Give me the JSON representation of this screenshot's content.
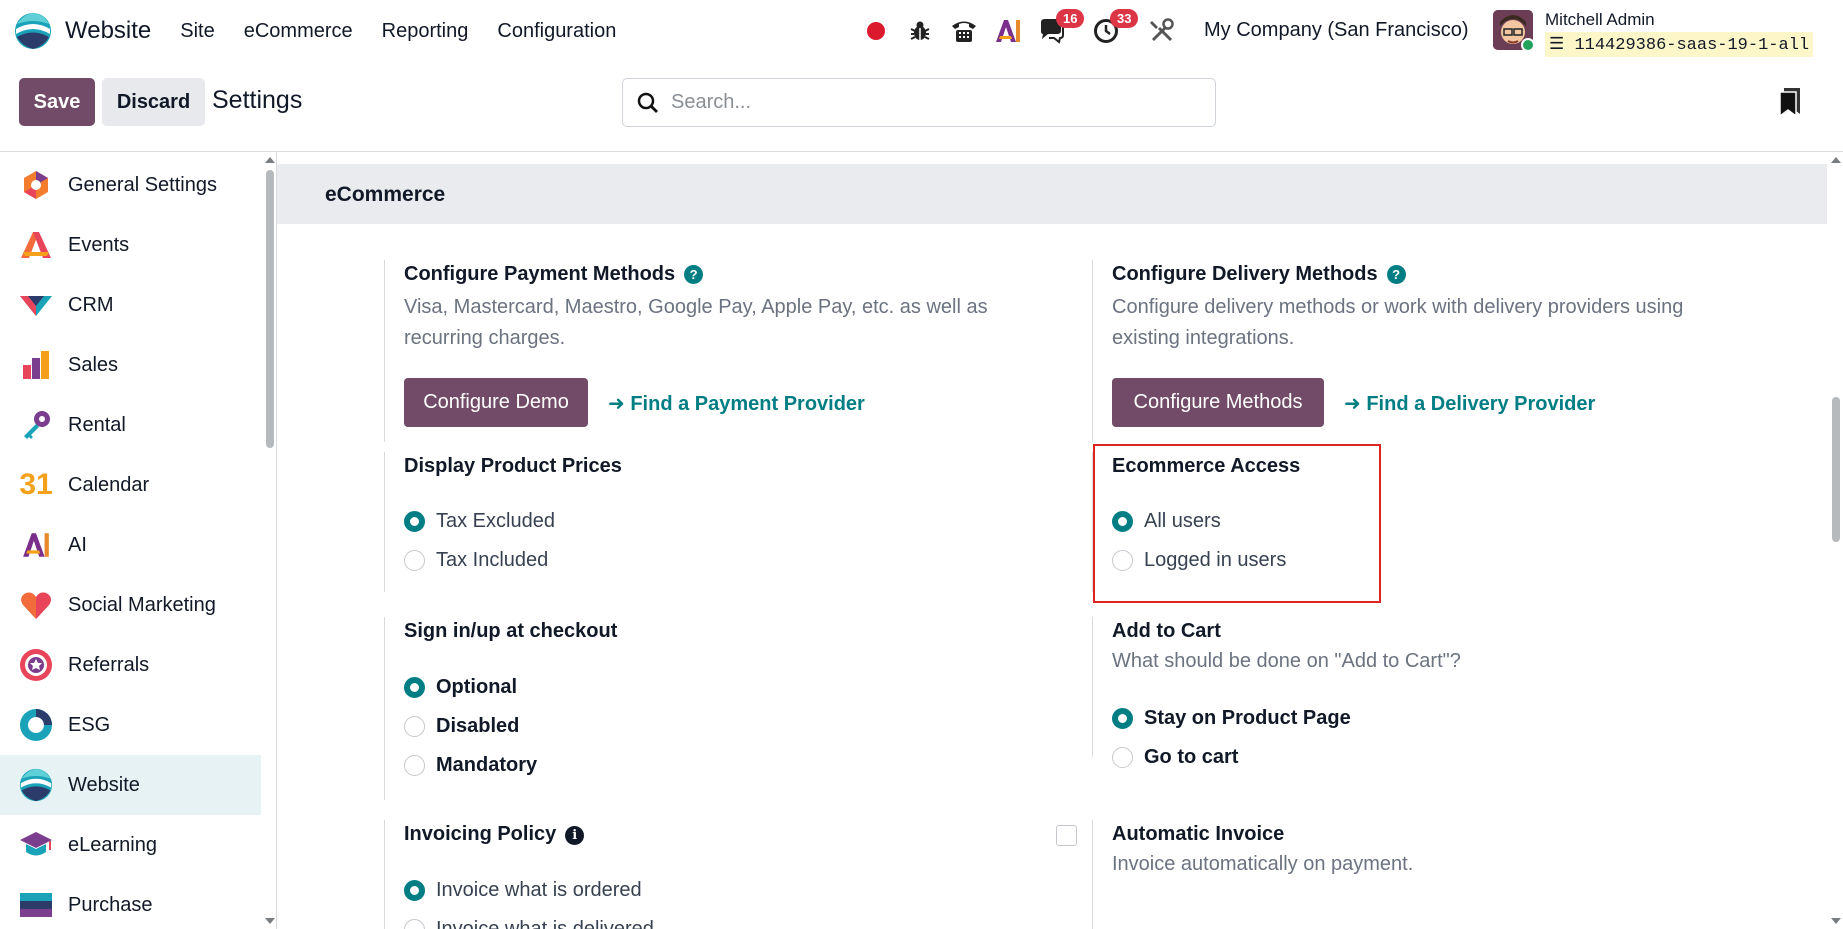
{
  "navbar": {
    "app_name": "Website",
    "menu": [
      "Site",
      "eCommerce",
      "Reporting",
      "Configuration"
    ],
    "badges": {
      "messages": "16",
      "activities": "33"
    },
    "company": "My Company (San Francisco)",
    "user_name": "Mitchell Admin",
    "db_name": "114429386-saas-19-1-all"
  },
  "control_panel": {
    "save_label": "Save",
    "discard_label": "Discard",
    "title": "Settings",
    "search_placeholder": "Search..."
  },
  "sidebar": {
    "items": [
      {
        "label": "General Settings",
        "icon": "general-settings-icon"
      },
      {
        "label": "Events",
        "icon": "events-icon"
      },
      {
        "label": "CRM",
        "icon": "crm-icon"
      },
      {
        "label": "Sales",
        "icon": "sales-icon"
      },
      {
        "label": "Rental",
        "icon": "rental-icon"
      },
      {
        "label": "Calendar",
        "icon": "calendar-icon"
      },
      {
        "label": "AI",
        "icon": "ai-icon"
      },
      {
        "label": "Social Marketing",
        "icon": "social-marketing-icon"
      },
      {
        "label": "Referrals",
        "icon": "referrals-icon"
      },
      {
        "label": "ESG",
        "icon": "esg-icon"
      },
      {
        "label": "Website",
        "icon": "website-icon",
        "active": true
      },
      {
        "label": "eLearning",
        "icon": "elearning-icon"
      },
      {
        "label": "Purchase",
        "icon": "purchase-icon"
      }
    ],
    "calendar_glyph": "31"
  },
  "main": {
    "section_title": "eCommerce",
    "payment": {
      "title": "Configure Payment Methods",
      "desc_line1": "Visa, Mastercard, Maestro, Google Pay, Apple Pay, etc. as well as",
      "desc_line2": "recurring charges.",
      "button": "Configure Demo",
      "link": "Find a Payment Provider"
    },
    "delivery": {
      "title": "Configure Delivery Methods",
      "desc_line1": "Configure delivery methods or work with delivery providers using",
      "desc_line2": "existing integrations.",
      "button": "Configure Methods",
      "link": "Find a Delivery Provider"
    },
    "prices": {
      "title": "Display Product Prices",
      "options": [
        "Tax Excluded",
        "Tax Included"
      ],
      "selected": "Tax Excluded"
    },
    "access": {
      "title": "Ecommerce Access",
      "options": [
        "All users",
        "Logged in users"
      ],
      "selected": "All users"
    },
    "signin": {
      "title": "Sign in/up at checkout",
      "options": [
        "Optional",
        "Disabled",
        "Mandatory"
      ],
      "selected": "Optional"
    },
    "cart": {
      "title": "Add to Cart",
      "desc": "What should be done on \"Add to Cart\"?",
      "options": [
        "Stay on Product Page",
        "Go to cart"
      ],
      "selected": "Stay on Product Page"
    },
    "invoicing": {
      "title": "Invoicing Policy",
      "options": [
        "Invoice what is ordered",
        "Invoice what is delivered"
      ],
      "selected": "Invoice what is ordered"
    },
    "auto_invoice": {
      "title": "Automatic Invoice",
      "desc": "Invoice automatically on payment.",
      "checked": false
    }
  },
  "colors": {
    "brand": "#714b67",
    "accent": "#017e84",
    "highlight": "#dc2626",
    "badge": "#dc3545"
  }
}
